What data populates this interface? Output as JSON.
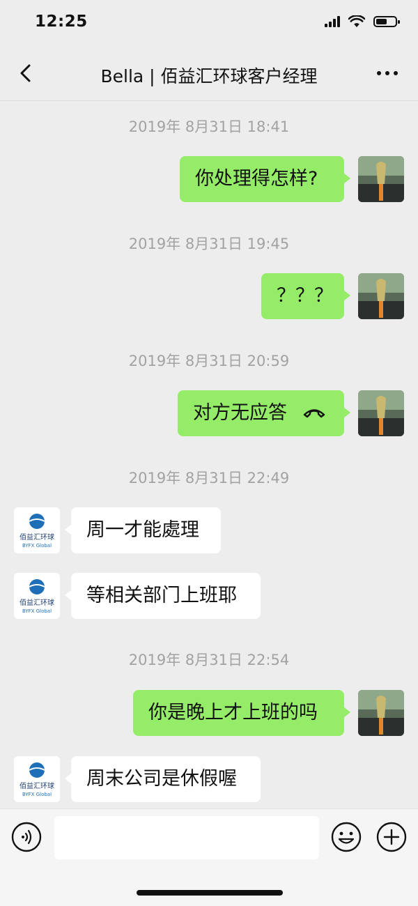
{
  "status_bar": {
    "time": "12:25"
  },
  "header": {
    "title": "Bella | 佰益汇环球客户经理"
  },
  "messages": [
    {
      "timestamp": "2019年 8月31日 18:41",
      "text": "你处理得怎样?",
      "from": "me"
    },
    {
      "timestamp": "2019年 8月31日 19:45",
      "text": "？？？",
      "from": "me"
    },
    {
      "timestamp": "2019年 8月31日 20:59",
      "text": "对方无应答",
      "from": "me",
      "icon": "hangup-phone-icon"
    },
    {
      "timestamp": "2019年 8月31日 22:49",
      "text": "周一才能處理",
      "from": "them"
    },
    {
      "text": "等相关部门上班耶",
      "from": "them"
    },
    {
      "timestamp": "2019年 8月31日 22:54",
      "text": "你是晚上才上班的吗",
      "from": "me"
    },
    {
      "text": "周末公司是休假喔",
      "from": "them"
    }
  ],
  "contact_avatar": {
    "logo_text": "佰益汇环球",
    "logo_subtext": "BYFX Global",
    "color": "#1e6fb8"
  },
  "input_bar": {
    "placeholder": "",
    "value": ""
  },
  "colors": {
    "background": "#ededed",
    "my_bubble": "#95ec69",
    "their_bubble": "#ffffff",
    "timestamp": "#a2a2a2"
  }
}
